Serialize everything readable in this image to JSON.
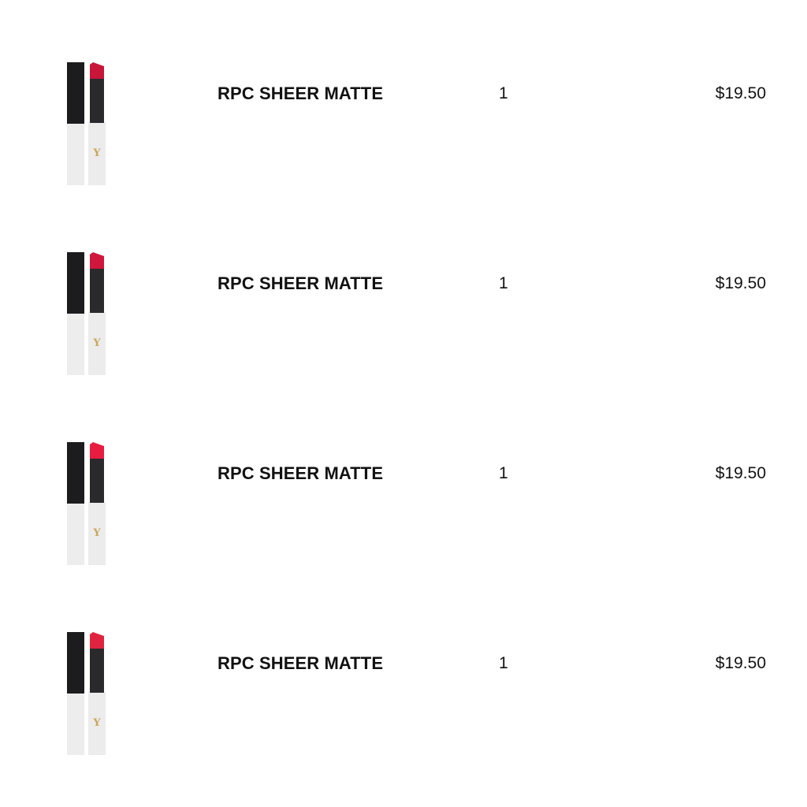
{
  "order": {
    "items": [
      {
        "name": "RPC SHEER MATTE",
        "quantity": "1",
        "price": "$19.50",
        "shade_color": "#c8153a",
        "image_icon": "lipstick-image"
      },
      {
        "name": "RPC SHEER MATTE",
        "quantity": "1",
        "price": "$19.50",
        "shade_color": "#d0163d",
        "image_icon": "lipstick-image"
      },
      {
        "name": "RPC SHEER MATTE",
        "quantity": "1",
        "price": "$19.50",
        "shade_color": "#e81c40",
        "image_icon": "lipstick-image"
      },
      {
        "name": "RPC SHEER MATTE",
        "quantity": "1",
        "price": "$19.50",
        "shade_color": "#e0243f",
        "image_icon": "lipstick-image"
      }
    ]
  },
  "colors": {
    "cap": "#1c1c1e",
    "tube_body": "#eeeeef",
    "stick_sleeve": "#2a2a2c",
    "logo_gold": "#c9a85a",
    "text": "#111111"
  }
}
